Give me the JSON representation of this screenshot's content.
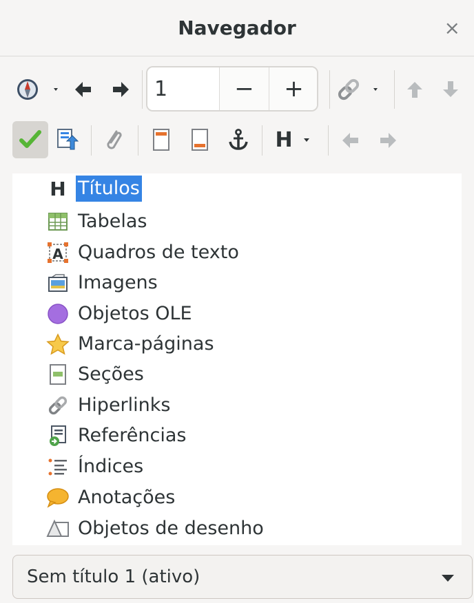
{
  "window": {
    "title": "Navegador",
    "close_glyph": "×"
  },
  "toolbar1": {
    "page_value": "1",
    "minus_label": "−",
    "plus_label": "+"
  },
  "toolbar2": {
    "heading_label": "H"
  },
  "tree": {
    "items": [
      {
        "label": "Títulos",
        "icon": "heading-icon",
        "selected": true
      },
      {
        "label": "Tabelas",
        "icon": "table-icon"
      },
      {
        "label": "Quadros de texto",
        "icon": "text-frame-icon"
      },
      {
        "label": "Imagens",
        "icon": "image-icon"
      },
      {
        "label": "Objetos OLE",
        "icon": "ole-object-icon"
      },
      {
        "label": "Marca-páginas",
        "icon": "bookmark-star-icon"
      },
      {
        "label": "Seções",
        "icon": "section-icon"
      },
      {
        "label": "Hiperlinks",
        "icon": "hyperlink-icon"
      },
      {
        "label": "Referências",
        "icon": "reference-icon"
      },
      {
        "label": "Índices",
        "icon": "index-icon"
      },
      {
        "label": "Anotações",
        "icon": "comment-icon"
      },
      {
        "label": "Objetos de desenho",
        "icon": "drawing-object-icon"
      }
    ]
  },
  "document_select": {
    "value": "Sem título 1 (ativo)"
  },
  "colors": {
    "selection": "#3584e4",
    "background": "#f6f5f4",
    "text": "#2e3436"
  }
}
